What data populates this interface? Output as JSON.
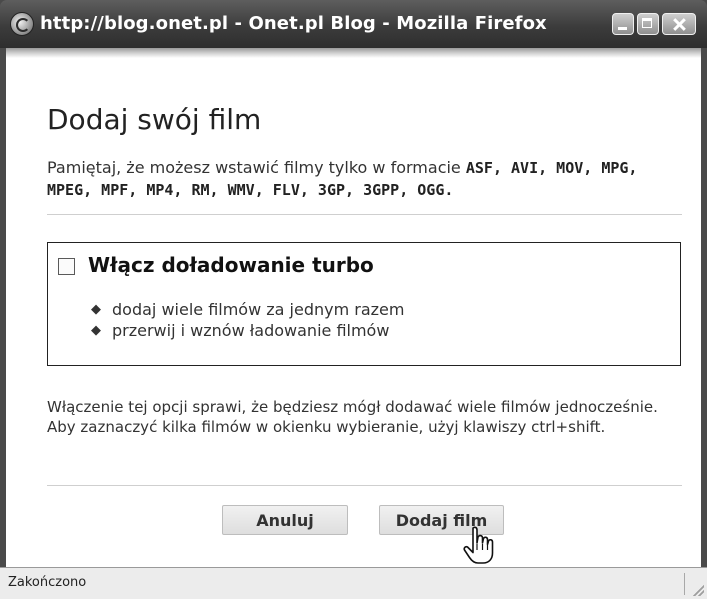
{
  "window": {
    "title": "http://blog.onet.pl - Onet.pl Blog - Mozilla Firefox"
  },
  "dialog": {
    "heading": "Dodaj swój film",
    "intro_text": "Pamiętaj, że możesz wstawić filmy tylko w formacie ",
    "formats": "ASF, AVI, MOV, MPG, MPEG, MPF, MP4, RM, WMV, FLV, 3GP, 3GPP, OGG.",
    "turbo": {
      "label": "Włącz doładowanie turbo",
      "checked": false,
      "features": [
        "dodaj wiele filmów za jednym razem",
        "przerwij i wznów ładowanie filmów"
      ]
    },
    "note": "Włączenie tej opcji sprawi, że będziesz mógł dodawać wiele filmów jednocześnie. Aby zaznaczyć kilka filmów w okienku wybieranie, użyj klawiszy ctrl+shift.",
    "buttons": {
      "cancel": "Anuluj",
      "add": "Dodaj film"
    }
  },
  "statusbar": {
    "text": "Zakończono"
  },
  "icons": {
    "app": "firefox-icon",
    "minimize": "minimize-icon",
    "maximize": "maximize-icon",
    "close": "close-icon",
    "bullet": "diamond-bullet-icon",
    "cursor": "hand-pointer-icon"
  }
}
